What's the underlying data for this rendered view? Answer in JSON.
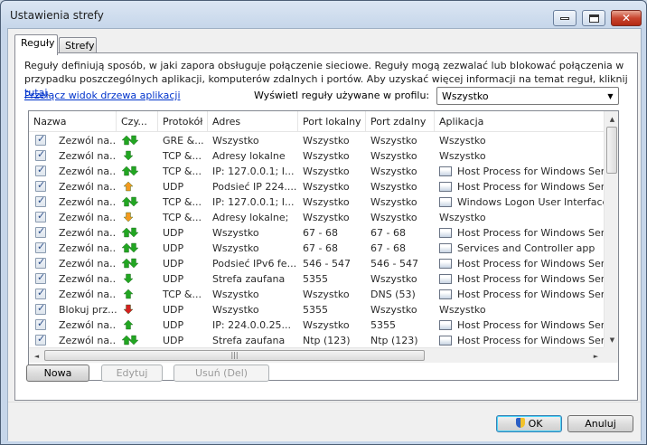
{
  "window": {
    "title": "Ustawienia strefy",
    "minimize_glyph": "—",
    "close_glyph": "✕"
  },
  "tabs": [
    {
      "label": "Reguły",
      "active": true
    },
    {
      "label": "Strefy",
      "active": false
    }
  ],
  "rules_tab": {
    "description": "Reguły definiują sposób, w jaki zapora obsługuje połączenie sieciowe. Reguły mogą zezwalać lub blokować połączenia w przypadku poszczególnych aplikacji, komputerów zdalnych i portów. Aby uzyskać więcej informacji na temat reguł, kliknij",
    "description_link": "tutaj",
    "description_end": ".",
    "tree_view_link": "Przełącz widok drzewa aplikacji",
    "profile_label": "Wyświetl reguły używane w profilu:",
    "profile_value": "Wszystko",
    "combo_arrow": "▼"
  },
  "columns": {
    "name": "Nazwa",
    "direction": "Czy...",
    "protocol": "Protokół",
    "address": "Adres",
    "local_port": "Port lokalny",
    "remote_port": "Port zdalny",
    "application": "Aplikacja"
  },
  "rules": [
    {
      "checked": true,
      "name": "Zezwól na...",
      "action": "allow",
      "direction": "both",
      "protocol": "GRE &...",
      "address": "Wszystko",
      "local_port": "Wszystko",
      "remote_port": "Wszystko",
      "app_icon": false,
      "application": "Wszystko"
    },
    {
      "checked": true,
      "name": "Zezwól na...",
      "action": "allow",
      "direction": "in",
      "protocol": "TCP &...",
      "address": "Adresy lokalne",
      "local_port": "Wszystko",
      "remote_port": "Wszystko",
      "app_icon": false,
      "application": "Wszystko"
    },
    {
      "checked": true,
      "name": "Zezwól na...",
      "action": "allow",
      "direction": "both",
      "protocol": "TCP &...",
      "address": "IP: 127.0.0.1; I...",
      "local_port": "Wszystko",
      "remote_port": "Wszystko",
      "app_icon": true,
      "application": "Host Process for Windows Service"
    },
    {
      "checked": true,
      "name": "Zezwól na...",
      "action": "ask",
      "direction": "out",
      "protocol": "UDP",
      "address": "Podsieć IP 224....",
      "local_port": "Wszystko",
      "remote_port": "Wszystko",
      "app_icon": true,
      "application": "Host Process for Windows Service"
    },
    {
      "checked": true,
      "name": "Zezwól na...",
      "action": "allow",
      "direction": "both",
      "protocol": "TCP &...",
      "address": "IP: 127.0.0.1; I...",
      "local_port": "Wszystko",
      "remote_port": "Wszystko",
      "app_icon": true,
      "application": "Windows Logon User Interface ..."
    },
    {
      "checked": true,
      "name": "Zezwól na...",
      "action": "ask",
      "direction": "in",
      "protocol": "TCP &...",
      "address": "Adresy lokalne;",
      "local_port": "Wszystko",
      "remote_port": "Wszystko",
      "app_icon": false,
      "application": "Wszystko"
    },
    {
      "checked": true,
      "name": "Zezwól na...",
      "action": "allow",
      "direction": "both",
      "protocol": "UDP",
      "address": "Wszystko",
      "local_port": "67 - 68",
      "remote_port": "67 - 68",
      "app_icon": true,
      "application": "Host Process for Windows Service"
    },
    {
      "checked": true,
      "name": "Zezwól na...",
      "action": "allow",
      "direction": "both",
      "protocol": "UDP",
      "address": "Wszystko",
      "local_port": "67 - 68",
      "remote_port": "67 - 68",
      "app_icon": true,
      "application": "Services and Controller app"
    },
    {
      "checked": true,
      "name": "Zezwól na...",
      "action": "allow",
      "direction": "both",
      "protocol": "UDP",
      "address": "Podsieć IPv6 fe...",
      "local_port": "546 - 547",
      "remote_port": "546 - 547",
      "app_icon": true,
      "application": "Host Process for Windows Service"
    },
    {
      "checked": true,
      "name": "Zezwól na...",
      "action": "allow",
      "direction": "in",
      "protocol": "UDP",
      "address": "Strefa zaufana",
      "local_port": "5355",
      "remote_port": "Wszystko",
      "app_icon": true,
      "application": "Host Process for Windows Service"
    },
    {
      "checked": true,
      "name": "Zezwól na...",
      "action": "allow",
      "direction": "out",
      "protocol": "TCP &...",
      "address": "Wszystko",
      "local_port": "Wszystko",
      "remote_port": "DNS (53)",
      "app_icon": true,
      "application": "Host Process for Windows Service"
    },
    {
      "checked": true,
      "name": "Blokuj prz...",
      "action": "block",
      "direction": "in",
      "protocol": "UDP",
      "address": "Wszystko",
      "local_port": "5355",
      "remote_port": "Wszystko",
      "app_icon": false,
      "application": "Wszystko"
    },
    {
      "checked": true,
      "name": "Zezwól na...",
      "action": "allow",
      "direction": "out",
      "protocol": "UDP",
      "address": "IP: 224.0.0.25...",
      "local_port": "Wszystko",
      "remote_port": "5355",
      "app_icon": true,
      "application": "Host Process for Windows Service"
    },
    {
      "checked": true,
      "name": "Zezwól na...",
      "action": "allow",
      "direction": "both",
      "protocol": "UDP",
      "address": "Strefa zaufana",
      "local_port": "Ntp (123)",
      "remote_port": "Ntp (123)",
      "app_icon": true,
      "application": "Host Process for Windows Service"
    }
  ],
  "scroll": {
    "up": "▲",
    "down": "▼",
    "left": "◄",
    "right": "►",
    "grip": "|||"
  },
  "action_buttons": {
    "new": "Nowa",
    "edit": "Edytuj",
    "delete": "Usuń (Del)"
  },
  "dialog_buttons": {
    "ok": "OK",
    "cancel": "Anuluj"
  },
  "colors": {
    "allow": "#22a622",
    "block": "#d42020",
    "ask": "#f39a1f",
    "link": "#0033cc"
  }
}
